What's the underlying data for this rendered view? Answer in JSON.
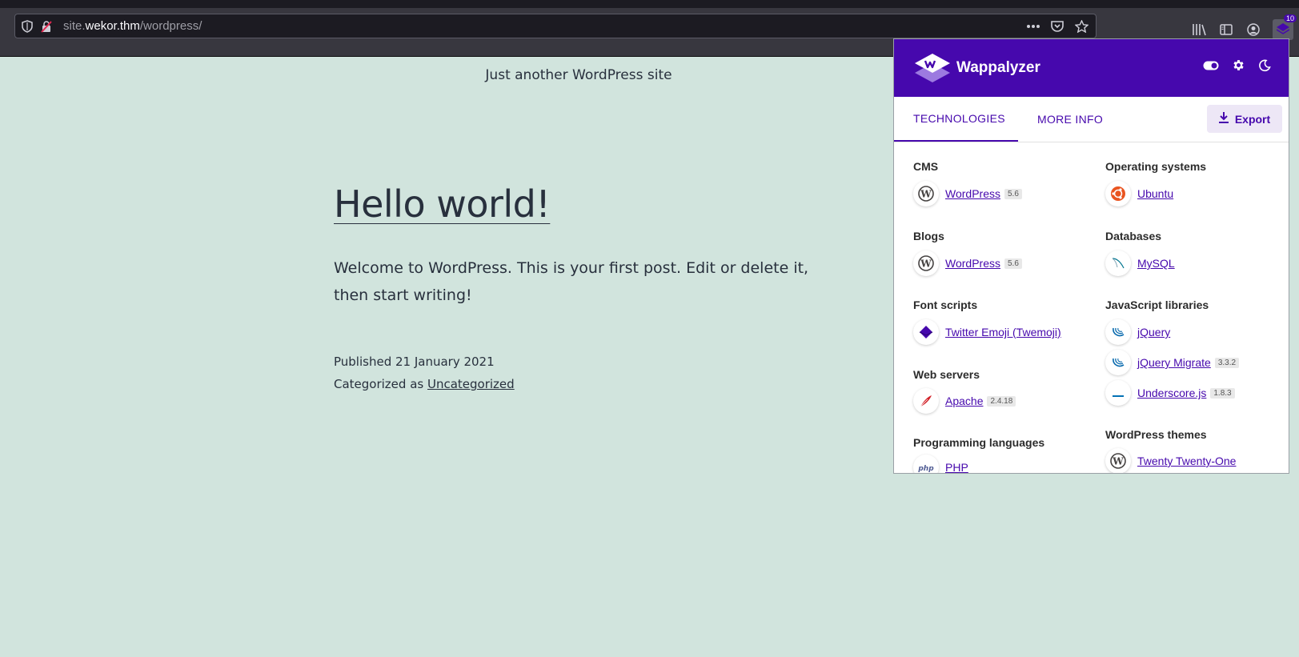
{
  "browser": {
    "url_prefix": "site.",
    "url_host": "wekor.thm",
    "url_path": "/wordpress/",
    "extension_badge": "10"
  },
  "page": {
    "site_description": "Just another WordPress site",
    "post_title": "Hello world!",
    "post_body": "Welcome to WordPress. This is your first post. Edit or delete it, then start writing!",
    "published": "Published 21 January 2021",
    "categorized_prefix": "Categorized as ",
    "category": "Uncategorized"
  },
  "wappalyzer": {
    "brand": "Wappalyzer",
    "tabs": [
      "TECHNOLOGIES",
      "MORE INFO"
    ],
    "export_label": "Export",
    "colors": {
      "brand": "#4608ad"
    },
    "left": [
      {
        "category": "CMS",
        "items": [
          {
            "name": "WordPress",
            "version": "5.6",
            "icon": "wordpress-icon"
          }
        ]
      },
      {
        "category": "Blogs",
        "items": [
          {
            "name": "WordPress",
            "version": "5.6",
            "icon": "wordpress-icon"
          }
        ]
      },
      {
        "category": "Font scripts",
        "items": [
          {
            "name": "Twitter Emoji (Twemoji)",
            "version": "",
            "icon": "twemoji-icon"
          }
        ]
      },
      {
        "category": "Web servers",
        "items": [
          {
            "name": "Apache",
            "version": "2.4.18",
            "icon": "apache-feather-icon"
          }
        ]
      },
      {
        "category": "Programming languages",
        "items": [
          {
            "name": "PHP",
            "version": "",
            "icon": "php-icon"
          }
        ]
      }
    ],
    "right": [
      {
        "category": "Operating systems",
        "items": [
          {
            "name": "Ubuntu",
            "version": "",
            "icon": "ubuntu-icon"
          }
        ]
      },
      {
        "category": "Databases",
        "items": [
          {
            "name": "MySQL",
            "version": "",
            "icon": "mysql-icon"
          }
        ]
      },
      {
        "category": "JavaScript libraries",
        "items": [
          {
            "name": "jQuery",
            "version": "",
            "icon": "jquery-icon"
          },
          {
            "name": "jQuery Migrate",
            "version": "3.3.2",
            "icon": "jquery-icon"
          },
          {
            "name": "Underscore.js",
            "version": "1.8.3",
            "icon": "underscore-icon"
          }
        ]
      },
      {
        "category": "WordPress themes",
        "items": [
          {
            "name": "Twenty Twenty-One",
            "version": "",
            "icon": "wordpress-icon"
          }
        ]
      }
    ]
  }
}
